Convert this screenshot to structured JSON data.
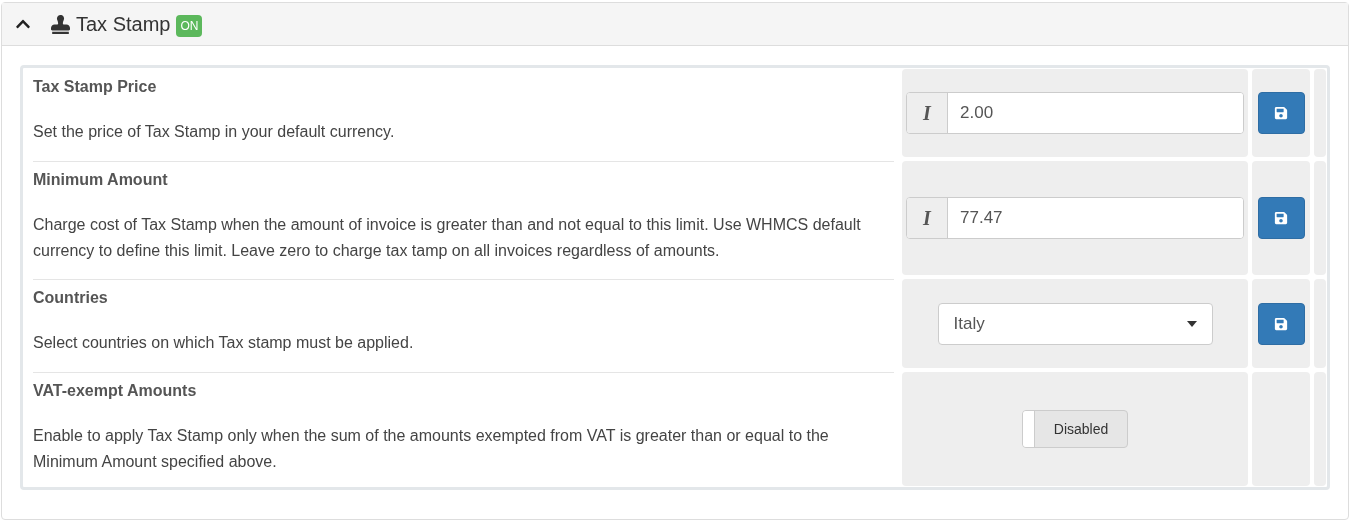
{
  "panel": {
    "title": "Tax Stamp",
    "badge": "ON",
    "expanded": true
  },
  "settings": [
    {
      "kind": "input",
      "label": "Tax Stamp Price",
      "description": "Set the price of Tax Stamp in your default currency.",
      "addon": "I",
      "value": "2.00"
    },
    {
      "kind": "input",
      "label": "Minimum Amount",
      "description": "Charge cost of Tax Stamp when the amount of invoice is greater than and not equal to this limit. Use WHMCS default currency to define this limit. Leave zero to charge tax tamp on all invoices regardless of amounts.",
      "addon": "I",
      "value": "77.47"
    },
    {
      "kind": "select",
      "label": "Countries",
      "description": "Select countries on which Tax stamp must be applied.",
      "value": "Italy"
    },
    {
      "kind": "toggle",
      "label": "VAT-exempt Amounts",
      "description": "Enable to apply Tax Stamp only when the sum of the amounts exempted from VAT is greater than or equal to the Minimum Amount specified above.",
      "toggle_label": "Disabled",
      "on": false
    }
  ]
}
